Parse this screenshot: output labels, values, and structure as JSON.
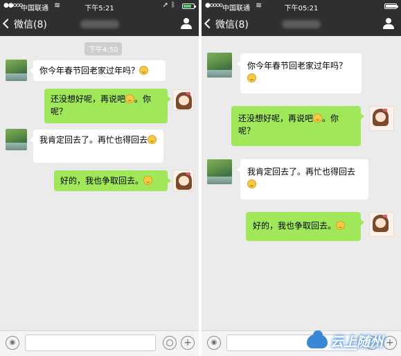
{
  "left": {
    "status": {
      "signal": "●●ooo",
      "carrier": "中国联通",
      "time": "下午5:21"
    },
    "nav": {
      "back_label": "微信(8)"
    },
    "chat": {
      "timestamp": "下午4:50",
      "messages": [
        {
          "from": "other",
          "text": "你今年春节回老家过年吗？"
        },
        {
          "from": "me",
          "text": "还没想好呢，再说吧",
          "text2": "。你呢？"
        },
        {
          "from": "other",
          "text": "我肯定回去了。再忙也得回去"
        },
        {
          "from": "me",
          "text": "好的，我也争取回去。"
        }
      ]
    }
  },
  "right": {
    "status": {
      "signal": "●oooo",
      "carrier": "中国联通",
      "time": "下午05:21"
    },
    "nav": {
      "back_label": "微信(8)"
    },
    "chat": {
      "messages": [
        {
          "from": "other",
          "text": "你今年春节回老家过年吗？"
        },
        {
          "from": "me",
          "text": "还没想好呢，再说吧",
          "text2": "。你呢？"
        },
        {
          "from": "other",
          "text": "我肯定回去了。再忙也得回去"
        },
        {
          "from": "me",
          "text": "好的，我也争取回去。"
        }
      ]
    },
    "watermark": "云上随州"
  },
  "colors": {
    "bar": "#2f2f31",
    "chat_bg": "#ebebeb",
    "sent_bubble": "#a0e75a",
    "received_bubble": "#ffffff"
  },
  "icons": [
    "back-chevron-icon",
    "person-icon",
    "voice-icon",
    "emoji-icon",
    "plus-icon",
    "wifi-icon",
    "battery-icon",
    "location-icon",
    "bluetooth-icon"
  ]
}
